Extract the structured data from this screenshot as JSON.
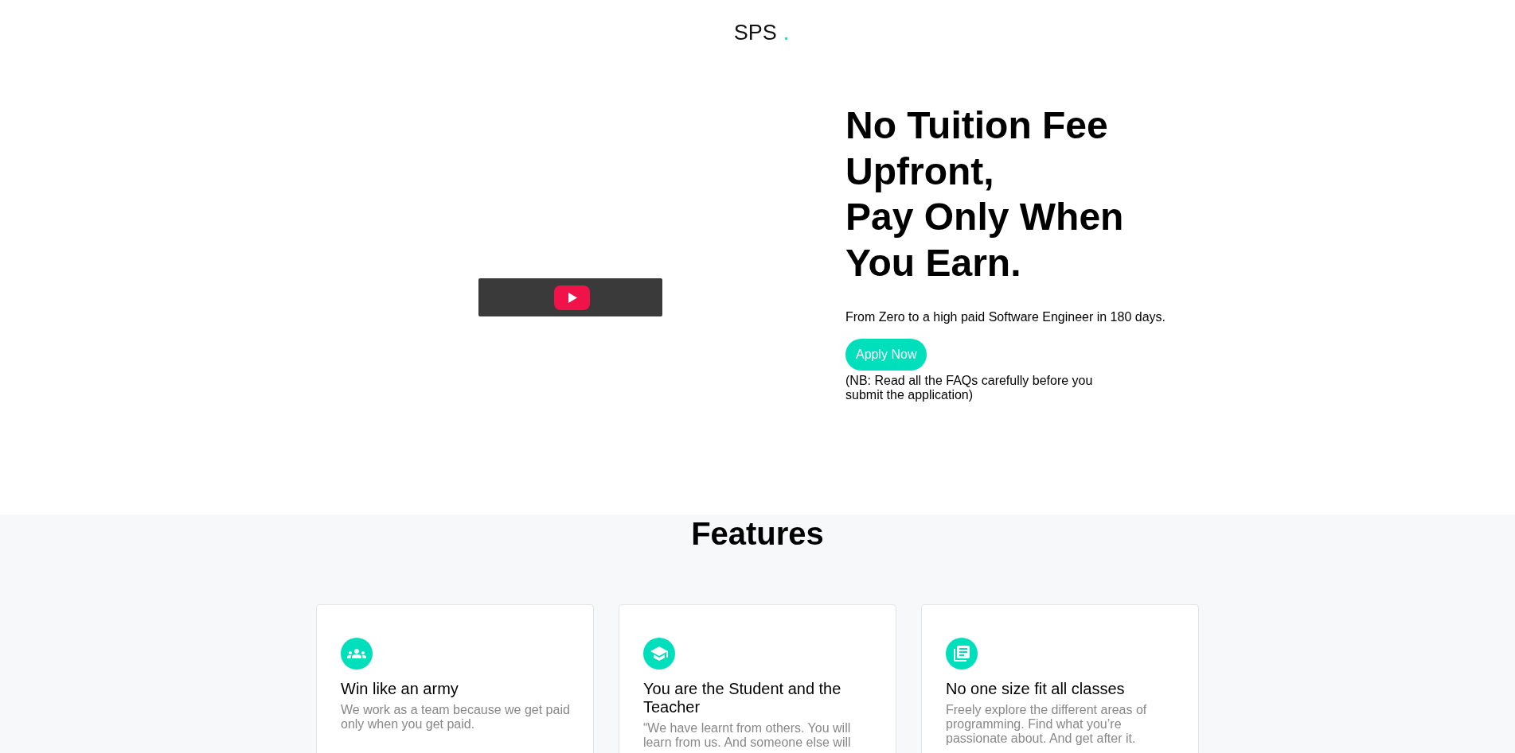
{
  "header": {
    "logo": "SPS",
    "logo_dot": "."
  },
  "hero": {
    "headline": [
      "No Tuition Fee Upfront,",
      "Pay Only When You Earn."
    ],
    "subtitle": "From Zero to a high paid Software Engineer in 180 days.",
    "cta_button": "Apply Now",
    "note": "(NB: Read all the FAQs carefully before you submit the application)"
  },
  "features": {
    "title": "Features",
    "cards": [
      {
        "kind": "team",
        "title": "Win like an army",
        "description": "We work as a team because we get paid only when you get paid."
      },
      {
        "kind": "learning",
        "title": "You are the Student and the Teacher",
        "description": "“We have learnt from others. You will learn from us. And someone else will"
      },
      {
        "kind": "curriculum",
        "title": "No one size fit all classes",
        "description": "Freely explore the different areas of programming. Find what you’re passionate about. And get after it."
      }
    ]
  }
}
